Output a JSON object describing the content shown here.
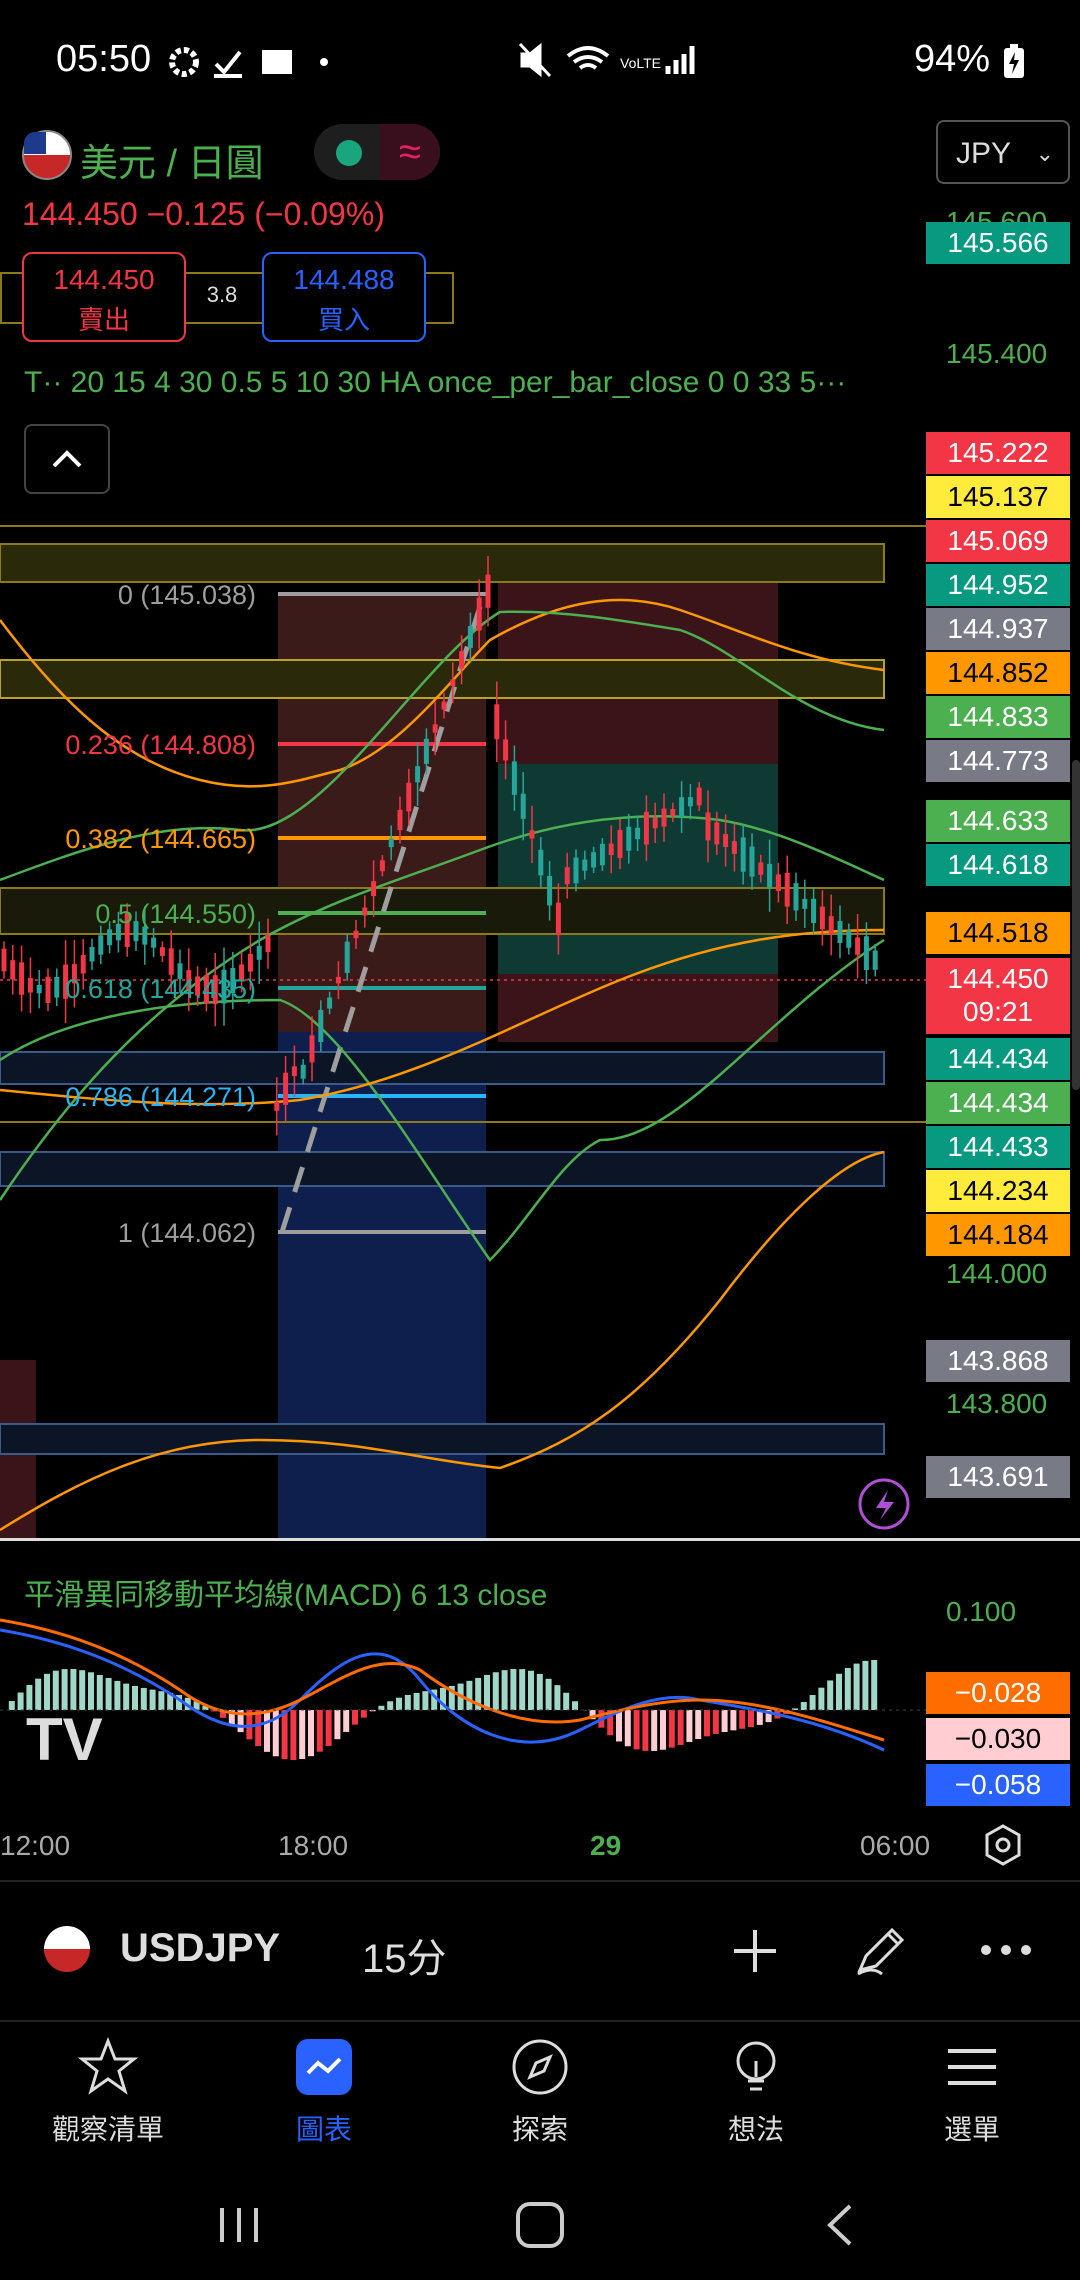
{
  "status_bar": {
    "time": "05:50",
    "battery": "94%"
  },
  "header": {
    "symbol_title": "美元 / 日圓",
    "currency_select": "JPY",
    "price_line": "144.450  −0.125 (−0.09%)",
    "sell": {
      "price": "144.450",
      "label": "賣出"
    },
    "buy": {
      "price": "144.488",
      "label": "買入"
    },
    "spread": "3.8",
    "strategy_line": "T·· 20 15 4 30 0.5 5 10 30 HA once_per_bar_close 0 0 33 5···"
  },
  "fib_levels": [
    {
      "label": "0 (145.038)",
      "color": "#9e9e9e"
    },
    {
      "label": "0.236 (144.808)",
      "color": "#f23645"
    },
    {
      "label": "0.382 (144.665)",
      "color": "#ff9800"
    },
    {
      "label": "0.5 (144.550)",
      "color": "#4caf50"
    },
    {
      "label": "0.618 (144.435)",
      "color": "#26a69a"
    },
    {
      "label": "0.786 (144.271)",
      "color": "#29b6f6"
    },
    {
      "label": "1 (144.062)",
      "color": "#9e9e9e"
    }
  ],
  "price_scale_texts": [
    "145.600",
    "145.400",
    "144.000",
    "143.800"
  ],
  "price_labels": [
    {
      "value": "145.566",
      "bg": "#089981",
      "fg": "#ffffff"
    },
    {
      "value": "145.222",
      "bg": "#f23645",
      "fg": "#ffffff"
    },
    {
      "value": "145.137",
      "bg": "#ffeb3b",
      "fg": "#000000"
    },
    {
      "value": "145.069",
      "bg": "#f23645",
      "fg": "#ffffff"
    },
    {
      "value": "144.952",
      "bg": "#089981",
      "fg": "#ffffff"
    },
    {
      "value": "144.937",
      "bg": "#787b86",
      "fg": "#ffffff"
    },
    {
      "value": "144.852",
      "bg": "#ff9800",
      "fg": "#000000"
    },
    {
      "value": "144.833",
      "bg": "#4caf50",
      "fg": "#ffffff"
    },
    {
      "value": "144.773",
      "bg": "#787b86",
      "fg": "#ffffff"
    },
    {
      "value": "144.633",
      "bg": "#4caf50",
      "fg": "#ffffff"
    },
    {
      "value": "144.618",
      "bg": "#089981",
      "fg": "#ffffff"
    },
    {
      "value": "144.518",
      "bg": "#ff9800",
      "fg": "#000000"
    },
    {
      "value": "144.450",
      "bg": "#f23645",
      "fg": "#ffffff"
    },
    {
      "value": "144.434",
      "bg": "#089981",
      "fg": "#ffffff"
    },
    {
      "value": "144.434",
      "bg": "#4caf50",
      "fg": "#ffffff"
    },
    {
      "value": "144.433",
      "bg": "#089981",
      "fg": "#ffffff"
    },
    {
      "value": "144.234",
      "bg": "#ffeb3b",
      "fg": "#000000"
    },
    {
      "value": "144.184",
      "bg": "#ff9800",
      "fg": "#000000"
    },
    {
      "value": "143.868",
      "bg": "#787b86",
      "fg": "#ffffff"
    },
    {
      "value": "143.691",
      "bg": "#787b86",
      "fg": "#ffffff"
    }
  ],
  "countdown": "09:21",
  "macd": {
    "title": "平滑異同移動平均線(MACD) 6 13 close",
    "scale_text": "0.100",
    "labels": [
      {
        "value": "−0.028",
        "bg": "#ff6d00",
        "fg": "#ffffff"
      },
      {
        "value": "−0.030",
        "bg": "#ffcdd2",
        "fg": "#000000"
      },
      {
        "value": "−0.058",
        "bg": "#2962ff",
        "fg": "#ffffff"
      }
    ]
  },
  "time_axis": [
    "12:00",
    "18:00",
    "29",
    "06:00"
  ],
  "toolbar": {
    "symbol": "USDJPY",
    "timeframe": "15分"
  },
  "bottom_nav": [
    "觀察清單",
    "圖表",
    "探索",
    "想法",
    "選單"
  ],
  "colors": {
    "accent_green": "#4CAF50",
    "accent_blue": "#2962ff",
    "down_red": "#f23645",
    "up_teal": "#26a69a"
  }
}
